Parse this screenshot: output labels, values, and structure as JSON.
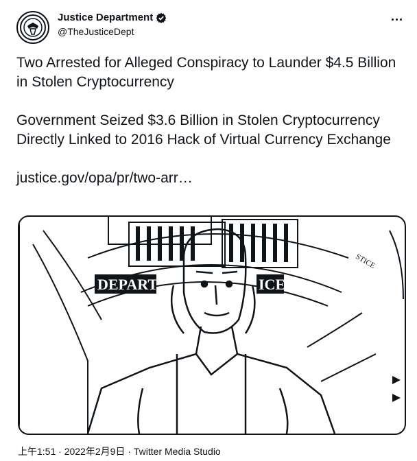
{
  "author": {
    "display_name": "Justice Department",
    "handle": "@TheJusticeDept",
    "verified_icon": "verified-badge-icon"
  },
  "tweet": {
    "line1": "Two Arrested for Alleged Conspiracy to Launder $4.5 Billion in Stolen Cryptocurrency",
    "line2": "Government Seized $3.6 Billion in Stolen Cryptocurrency Directly Linked to 2016 Hack of Virtual Currency Exchange",
    "link": "justice.gov/opa/pr/two-arr…"
  },
  "media": {
    "banner_left": "DEPART",
    "banner_right": "ICE"
  },
  "meta": {
    "time": "上午1:51",
    "sep1": " · ",
    "date": "2022年2月9日",
    "sep2": " · ",
    "source": "Twitter Media Studio"
  },
  "colors": {
    "text": "#0f1419",
    "background": "#ffffff"
  }
}
